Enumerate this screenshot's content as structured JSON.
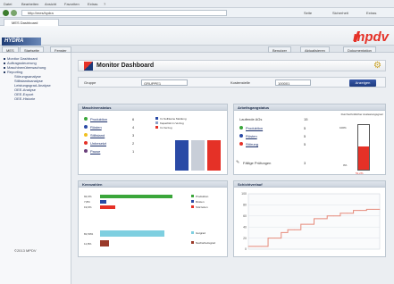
{
  "browser": {
    "menu": [
      "Datei",
      "Bearbeiten",
      "Ansicht",
      "Favoriten",
      "Extras",
      "?"
    ],
    "address": "http://mes/hydra",
    "tab": "MES Dashboard",
    "toolbar_right": [
      "Seite",
      "Sicherheit",
      "Extras"
    ]
  },
  "app": {
    "left_logo": "HYDRA",
    "brand": "mpdv",
    "nav_tabs": [
      "MES",
      "Startseite",
      "Fenster"
    ],
    "nav_right": [
      "Benutzer",
      "Aktualisieren",
      "Dokumentation"
    ]
  },
  "sidebar": {
    "items": [
      {
        "label": "Monitor Dashboard",
        "level": 0
      },
      {
        "label": "Auftragssteuerung",
        "level": 0
      },
      {
        "label": "Maschinenüberwachung",
        "level": 0
      },
      {
        "label": "Reporting",
        "level": 0
      },
      {
        "label": "Störungsanalyse",
        "level": 1
      },
      {
        "label": "Stillstandsanalyse",
        "level": 1
      },
      {
        "label": "Leistungsgrad-Analyse",
        "level": 1
      },
      {
        "label": "OEE-Analyse",
        "level": 1
      },
      {
        "label": "OEE-Export",
        "level": 1
      },
      {
        "label": "OEE-Historie",
        "level": 1
      }
    ],
    "footer": "©2013 MPDV"
  },
  "page": {
    "title": "Monitor Dashboard",
    "filters": [
      {
        "label": "Gruppe",
        "value": "GRUPPE1"
      },
      {
        "label": "Kostenstelle",
        "value": "100001"
      }
    ],
    "show_button": "Anzeigen"
  },
  "machine_status": {
    "title": "Maschinenstatus",
    "rows": [
      {
        "label": "Produktion",
        "value": "6",
        "color": "#3aa63a"
      },
      {
        "label": "Rüsten",
        "value": "4",
        "color": "#2a4aa6"
      },
      {
        "label": "Stillstand",
        "value": "3",
        "color": "#f0c020"
      },
      {
        "label": "Unbesetzt",
        "value": "2",
        "color": "#e53127"
      },
      {
        "label": "Pause",
        "value": "1",
        "color": "#6a3e7a"
      }
    ],
    "legend": [
      {
        "label": "Im Soll/keine Meldung",
        "color": "#2a4aa6"
      },
      {
        "label": "Kapazität im Verzug",
        "color": "#8aa0c8"
      },
      {
        "label": "Im Verzug",
        "color": "#e53127"
      }
    ],
    "bars": [
      {
        "color": "#2a4aa6",
        "value": 6
      },
      {
        "color": "#c8ced8",
        "value": 6
      },
      {
        "color": "#e53127",
        "value": 6
      }
    ]
  },
  "work_orders": {
    "title": "Arbeitsgangstatus",
    "total_label": "Laufende AGs",
    "total_value": "15",
    "rows": [
      {
        "label": "Produktion",
        "value": "5",
        "color": "#3aa63a"
      },
      {
        "label": "Rüsten",
        "value": "5",
        "color": "#2a4aa6"
      },
      {
        "label": "Störung",
        "value": "5",
        "color": "#e53127"
      }
    ],
    "inspections_label": "Fällige Prüfungen",
    "inspections_value": "3",
    "gauge_title": "Durchschnittlicher Auslastungsgrad",
    "gauge_value_pct": 51.2,
    "gauge_top": "100%",
    "gauge_bottom": "0%",
    "gauge_readout": "51,2%"
  },
  "key_figures": {
    "title": "Kennzahlen",
    "bars_top": [
      {
        "label": "92,0%",
        "value": 92.0,
        "color": "#3aa63a"
      },
      {
        "label": "7,8%",
        "value": 7.8,
        "color": "#2a4aa6"
      },
      {
        "label": "19,6%",
        "value": 19.6,
        "color": "#e53127"
      }
    ],
    "legend_top": [
      {
        "label": "Produktion",
        "color": "#3aa63a"
      },
      {
        "label": "Rüsten",
        "color": "#2a4aa6"
      },
      {
        "label": "Störzeiten",
        "color": "#e53127"
      }
    ],
    "bars_bottom": [
      {
        "label": "81,50%",
        "value": 81.5,
        "color": "#7ecfe0"
      },
      {
        "label": "11,8%",
        "value": 11.8,
        "color": "#9a3a2a"
      }
    ],
    "legend_bottom": [
      {
        "label": "Gutgrad",
        "color": "#7ecfe0"
      },
      {
        "label": "Nacharbeitsgrad",
        "color": "#9a3a2a"
      }
    ]
  },
  "chart_data": {
    "type": "line",
    "title": "Schichtverlauf",
    "xlabel": "",
    "ylabel": "",
    "ylim": [
      0,
      100
    ],
    "yticks": [
      "100",
      "80",
      "60",
      "40",
      "20",
      "0"
    ],
    "x": [
      0,
      1,
      2,
      3,
      4,
      5,
      6,
      7,
      8,
      9,
      10,
      11,
      12,
      13,
      14,
      15,
      16,
      17,
      18,
      19,
      20
    ],
    "series": [
      {
        "values": [
          5,
          5,
          5,
          20,
          20,
          30,
          35,
          35,
          45,
          45,
          55,
          55,
          60,
          60,
          65,
          65,
          70,
          70,
          72,
          72,
          72
        ],
        "color": "#e58a7a"
      }
    ]
  }
}
